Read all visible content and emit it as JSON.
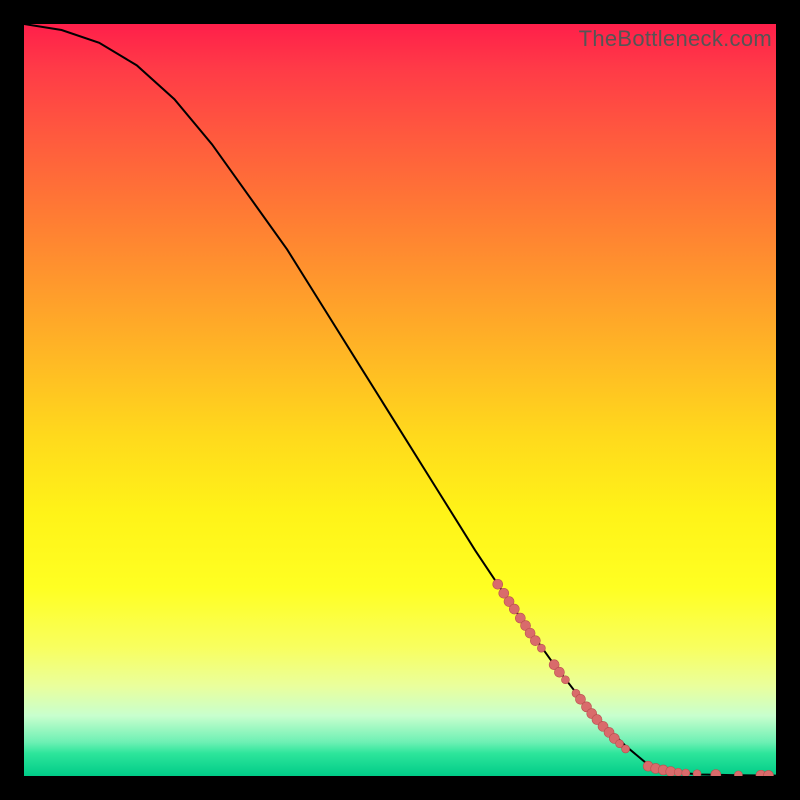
{
  "watermark": "TheBottleneck.com",
  "chart_data": {
    "type": "line",
    "title": "",
    "xlabel": "",
    "ylabel": "",
    "xlim": [
      0,
      100
    ],
    "ylim": [
      0,
      100
    ],
    "curve": [
      {
        "x": 0,
        "y": 100
      },
      {
        "x": 5,
        "y": 99.2
      },
      {
        "x": 10,
        "y": 97.5
      },
      {
        "x": 15,
        "y": 94.5
      },
      {
        "x": 20,
        "y": 90
      },
      {
        "x": 25,
        "y": 84
      },
      {
        "x": 30,
        "y": 77
      },
      {
        "x": 35,
        "y": 70
      },
      {
        "x": 40,
        "y": 62
      },
      {
        "x": 45,
        "y": 54
      },
      {
        "x": 50,
        "y": 46
      },
      {
        "x": 55,
        "y": 38
      },
      {
        "x": 60,
        "y": 30
      },
      {
        "x": 65,
        "y": 22.5
      },
      {
        "x": 70,
        "y": 15.5
      },
      {
        "x": 75,
        "y": 9
      },
      {
        "x": 80,
        "y": 4
      },
      {
        "x": 83,
        "y": 1.5
      },
      {
        "x": 85,
        "y": 0.6
      },
      {
        "x": 90,
        "y": 0.2
      },
      {
        "x": 95,
        "y": 0.1
      },
      {
        "x": 100,
        "y": 0.05
      }
    ],
    "scatter": [
      {
        "x": 63.0,
        "y": 25.5,
        "r": 5
      },
      {
        "x": 63.8,
        "y": 24.3,
        "r": 5
      },
      {
        "x": 64.5,
        "y": 23.2,
        "r": 5
      },
      {
        "x": 65.2,
        "y": 22.2,
        "r": 5
      },
      {
        "x": 66.0,
        "y": 21.0,
        "r": 5
      },
      {
        "x": 66.7,
        "y": 20.0,
        "r": 5
      },
      {
        "x": 67.3,
        "y": 19.0,
        "r": 5
      },
      {
        "x": 68.0,
        "y": 18.0,
        "r": 5
      },
      {
        "x": 68.8,
        "y": 17.0,
        "r": 4
      },
      {
        "x": 70.5,
        "y": 14.8,
        "r": 5
      },
      {
        "x": 71.2,
        "y": 13.8,
        "r": 5
      },
      {
        "x": 72.0,
        "y": 12.8,
        "r": 4
      },
      {
        "x": 73.4,
        "y": 11.0,
        "r": 4
      },
      {
        "x": 74.0,
        "y": 10.2,
        "r": 5
      },
      {
        "x": 74.8,
        "y": 9.2,
        "r": 5
      },
      {
        "x": 75.5,
        "y": 8.3,
        "r": 5
      },
      {
        "x": 76.2,
        "y": 7.5,
        "r": 5
      },
      {
        "x": 77.0,
        "y": 6.6,
        "r": 5
      },
      {
        "x": 77.8,
        "y": 5.8,
        "r": 5
      },
      {
        "x": 78.5,
        "y": 5.0,
        "r": 5
      },
      {
        "x": 79.2,
        "y": 4.3,
        "r": 4
      },
      {
        "x": 80.0,
        "y": 3.6,
        "r": 4
      },
      {
        "x": 83.0,
        "y": 1.3,
        "r": 5
      },
      {
        "x": 84.0,
        "y": 1.0,
        "r": 5
      },
      {
        "x": 85.0,
        "y": 0.8,
        "r": 5
      },
      {
        "x": 86.0,
        "y": 0.6,
        "r": 5
      },
      {
        "x": 87.0,
        "y": 0.5,
        "r": 4
      },
      {
        "x": 88.0,
        "y": 0.4,
        "r": 4
      },
      {
        "x": 89.5,
        "y": 0.3,
        "r": 4
      },
      {
        "x": 92.0,
        "y": 0.2,
        "r": 5
      },
      {
        "x": 95.0,
        "y": 0.15,
        "r": 4
      },
      {
        "x": 98.0,
        "y": 0.1,
        "r": 5
      },
      {
        "x": 99.0,
        "y": 0.08,
        "r": 5
      }
    ],
    "colors": {
      "curve": "#000000",
      "scatter_fill": "#d96b6b",
      "scatter_stroke": "#b94f4f",
      "gradient_top": "#ff1f4a",
      "gradient_mid": "#fff318",
      "gradient_bottom": "#00cc88",
      "frame": "#000000"
    }
  }
}
